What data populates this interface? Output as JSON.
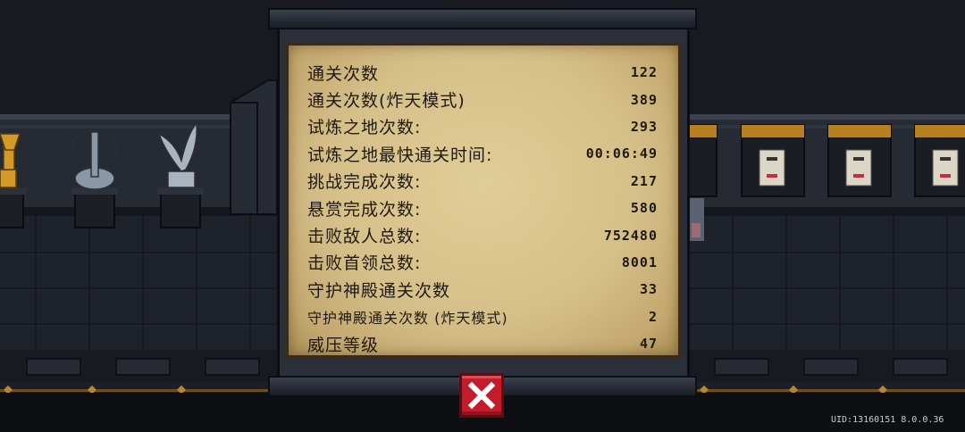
{
  "stats": [
    {
      "label": "通关次数",
      "value": "122"
    },
    {
      "label": "通关次数(炸天模式)",
      "value": "389"
    },
    {
      "label": "试炼之地次数:",
      "value": "293"
    },
    {
      "label": "试炼之地最快通关时间:",
      "value": "00:06:49"
    },
    {
      "label": "挑战完成次数:",
      "value": "217"
    },
    {
      "label": "悬赏完成次数:",
      "value": "580"
    },
    {
      "label": "击败敌人总数:",
      "value": "752480"
    },
    {
      "label": "击败首领总数:",
      "value": "8001"
    },
    {
      "label": "守护神殿通关次数",
      "value": "33"
    },
    {
      "label": "守护神殿通关次数 (炸天模式)",
      "value": "2"
    },
    {
      "label": "威压等级",
      "value": "47"
    }
  ],
  "footer": {
    "uid": "UID:13160151 8.0.0.36"
  },
  "colors": {
    "parchment": "#d6c08a",
    "close_button": "#c31d2b",
    "background": "#1c1f27"
  },
  "icons": {
    "close": "close-x-icon"
  }
}
